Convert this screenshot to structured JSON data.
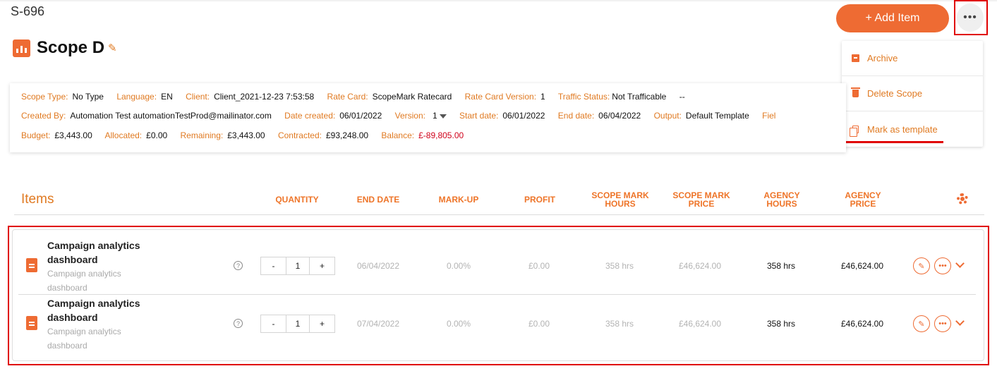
{
  "header": {
    "scope_id": "S-696",
    "title": "Scope D",
    "add_item_label": "+ Add Item",
    "more_label": "•••"
  },
  "menu": {
    "items": [
      {
        "label": "Archive",
        "icon": "archive-icon"
      },
      {
        "label": "Delete Scope",
        "icon": "trash-icon"
      },
      {
        "label": "Mark as template",
        "icon": "copy-icon"
      }
    ]
  },
  "info": {
    "row1": [
      {
        "k": "Scope Type:",
        "v": "No Type"
      },
      {
        "k": "Language:",
        "v": "EN"
      },
      {
        "k": "Client:",
        "v": "Client_2021-12-23 7:53:58"
      },
      {
        "k": "Rate Card:",
        "v": "ScopeMark Ratecard"
      },
      {
        "k": "Rate Card Version:",
        "v": "1"
      },
      {
        "k": "Traffic Status:",
        "v": "Not Trafficable"
      }
    ],
    "row1_extra": "--",
    "row2": [
      {
        "k": "Created By:",
        "v": "Automation Test automationTestProd@mailinator.com"
      },
      {
        "k": "Date created:",
        "v": "06/01/2022"
      },
      {
        "k": "Version:",
        "v": "1"
      },
      {
        "k": "Start date:",
        "v": "06/01/2022"
      },
      {
        "k": "End date:",
        "v": "06/04/2022"
      },
      {
        "k": "Output:",
        "v": "Default Template"
      },
      {
        "k": "Fiel",
        "v": ""
      }
    ],
    "row3": [
      {
        "k": "Budget:",
        "v": "£3,443.00"
      },
      {
        "k": "Allocated:",
        "v": "£0.00"
      },
      {
        "k": "Remaining:",
        "v": "£3,443.00"
      },
      {
        "k": "Contracted:",
        "v": "£93,248.00"
      },
      {
        "k": "Balance:",
        "v": "£-89,805.00"
      }
    ]
  },
  "items_header": {
    "title": "Items",
    "columns": [
      "QUANTITY",
      "END DATE",
      "MARK-UP",
      "PROFIT",
      "SCOPE MARK\nHOURS",
      "SCOPE MARK\nPRICE",
      "AGENCY\nHOURS",
      "AGENCY\nPRICE"
    ]
  },
  "items": [
    {
      "name": "Campaign analytics dashboard",
      "description": "Campaign analytics dashboard",
      "quantity": "1",
      "end_date": "06/04/2022",
      "markup": "0.00%",
      "profit": "£0.00",
      "sm_hours": "358 hrs",
      "sm_price": "£46,624.00",
      "agency_hours": "358 hrs",
      "agency_price": "£46,624.00"
    },
    {
      "name": "Campaign analytics dashboard",
      "description": "Campaign analytics dashboard",
      "quantity": "1",
      "end_date": "07/04/2022",
      "markup": "0.00%",
      "profit": "£0.00",
      "sm_hours": "358 hrs",
      "sm_price": "£46,624.00",
      "agency_hours": "358 hrs",
      "agency_price": "£46,624.00"
    }
  ],
  "stepper": {
    "minus": "-",
    "plus": "+"
  },
  "help_glyph": "?",
  "colors": {
    "accent": "#ee6b33",
    "highlight": "#e00000",
    "negative": "#d0021b"
  }
}
